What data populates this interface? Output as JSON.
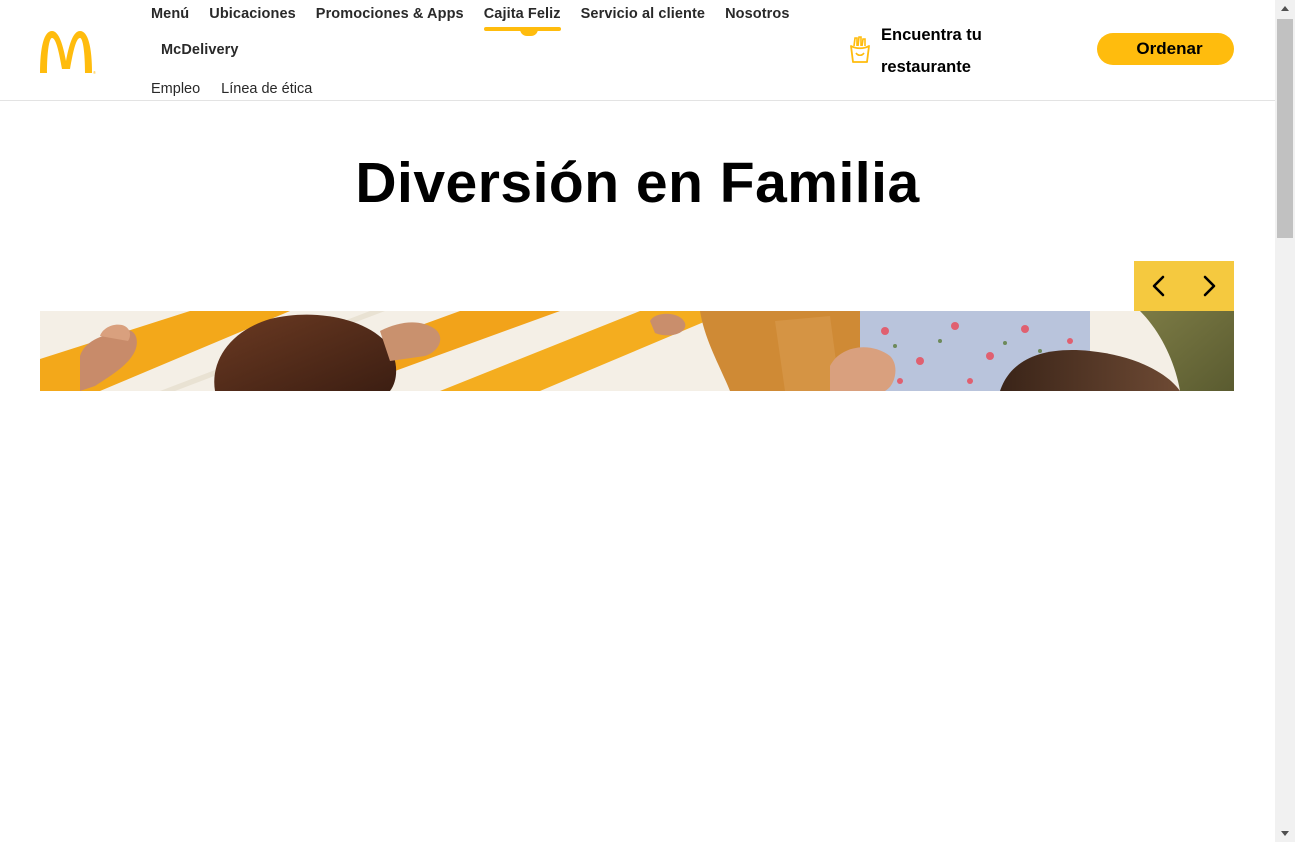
{
  "header": {
    "logo": "mcdonalds-golden-arches-logo",
    "nav_primary": [
      {
        "label": "Menú",
        "active": false
      },
      {
        "label": "Ubicaciones",
        "active": false
      },
      {
        "label": "Promociones & Apps",
        "active": false
      },
      {
        "label": "Cajita Feliz",
        "active": true
      },
      {
        "label": "Servicio al cliente",
        "active": false
      },
      {
        "label": "Nosotros",
        "active": false
      },
      {
        "label": "McDelivery",
        "active": false
      }
    ],
    "nav_secondary": [
      {
        "label": "Empleo"
      },
      {
        "label": "Línea de ética"
      }
    ],
    "find_restaurant": {
      "line1": "Encuentra tu",
      "line2": "restaurante",
      "icon": "fries-icon"
    },
    "order_label": "Ordenar"
  },
  "main": {
    "title": "Diversión en Familia",
    "carousel": {
      "prev_icon": "chevron-left-icon",
      "next_icon": "chevron-right-icon"
    }
  },
  "colors": {
    "brand_yellow": "#ffbc0d",
    "carousel_controls": "#f5c93f",
    "text": "#292929"
  }
}
